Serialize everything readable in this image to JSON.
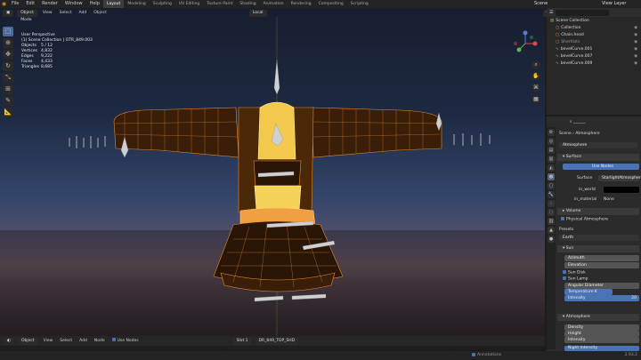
{
  "menu": [
    "File",
    "Edit",
    "Render",
    "Window",
    "Help"
  ],
  "workspaces": [
    "Layout",
    "Modeling",
    "Sculpting",
    "UV Editing",
    "Texture Paint",
    "Shading",
    "Animation",
    "Rendering",
    "Compositing",
    "Scripting"
  ],
  "active_workspace": "Layout",
  "scene": "Scene",
  "view_layer": "View Layer",
  "vp_header": {
    "mode": "Object Mode",
    "view": "View",
    "select": "Select",
    "add": "Add",
    "object": "Object",
    "transform": "Local",
    "options": "Options"
  },
  "stats": {
    "title": "User Perspective",
    "collection": "(1) Scene Collection | OTR_849.003",
    "rows": [
      {
        "k": "Objects",
        "v": "5 / 12"
      },
      {
        "k": "Vertices",
        "v": "4,832"
      },
      {
        "k": "Edges",
        "v": "9,222"
      },
      {
        "k": "Faces",
        "v": "4,433"
      },
      {
        "k": "Triangles",
        "v": "8,685"
      }
    ]
  },
  "bottom": {
    "object": "Object",
    "view": "View",
    "select": "Select",
    "add": "Add",
    "node": "Node",
    "use_nodes": "Use Nodes",
    "slot": "Slot 1",
    "material": "DR_849_TOP_SHD"
  },
  "status": {
    "ver": "2.93.2",
    "annotations": "Annotations"
  },
  "outliner": {
    "root": "Scene Collection",
    "items": [
      "Collection",
      "Chain.head",
      "Shortlists",
      "bevelCurve.001",
      "bevelCurve.007",
      "bevelCurve.009"
    ]
  },
  "props": {
    "scene": "Scene",
    "atmosphere": "Atmosphere",
    "world_name": "Atmosphere",
    "surface_panel": "Surface",
    "use_nodes_btn": "Use Nodes",
    "surface_label": "Surface",
    "surface_value": "StarlightAtmosphere",
    "in_world": "in_world",
    "in_material": "in_material",
    "in_material_value": "None",
    "volume": "Volume",
    "physical": "Physical Atmosphere",
    "presets": "Presets",
    "preset_value": "Earth",
    "sun": "Sun",
    "azimuth": "Azimuth",
    "elevation": "Elevation",
    "sun_disk": "Sun Disk",
    "sun_lamp": "Sun Lamp",
    "angular": "Angular Diameter",
    "temperature": "Temperature K",
    "intensity": "Intensity",
    "intensity_value": "20",
    "atm_panel": "Atmosphere",
    "density": "Density",
    "height": "Height",
    "atm_intensity": "Intensity",
    "night": "Night Intensity"
  }
}
